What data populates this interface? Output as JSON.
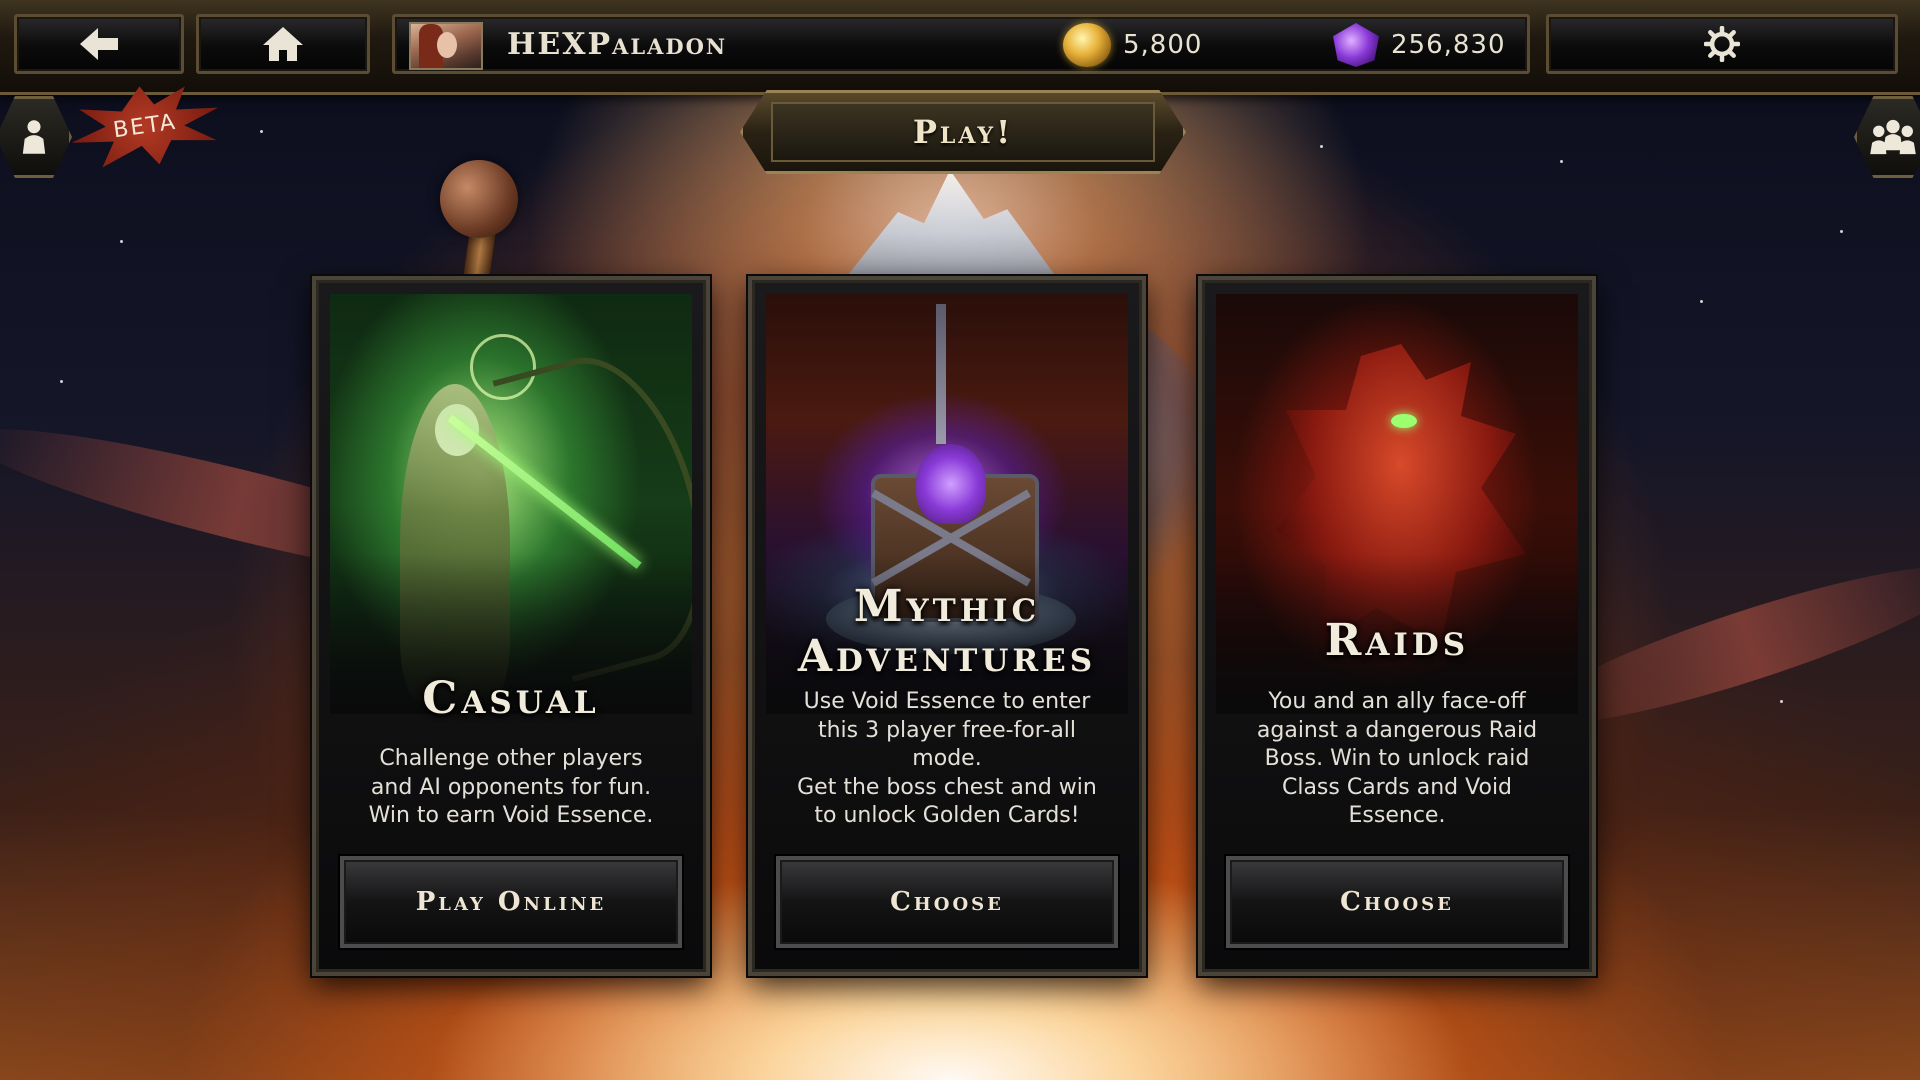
{
  "topbar": {
    "player_name": "HEXPaladon",
    "gold": "5,800",
    "platinum": "256,830"
  },
  "beta_label": "BETA",
  "banner": {
    "title": "Play!"
  },
  "cards": [
    {
      "title": "Casual",
      "description": "Challenge other players\nand AI opponents for fun.\nWin to earn Void Essence.",
      "button": "Play Online"
    },
    {
      "title": "Mythic\nAdventures",
      "description": "Use Void Essence to enter\nthis 3 player free-for-all\nmode.\nGet the boss chest and win\nto unlock Golden Cards!",
      "button": "Choose"
    },
    {
      "title": "Raids",
      "description": "You and an ally face-off\nagainst a dangerous Raid\nBoss. Win to unlock raid\nClass Cards and Void\nEssence.",
      "button": "Choose"
    }
  ],
  "colors": {
    "frame_gold": "#6a5a38",
    "title_text": "#f1ebdb",
    "gold_currency": "#e8b23a",
    "platinum_currency": "#8a3ad8"
  }
}
